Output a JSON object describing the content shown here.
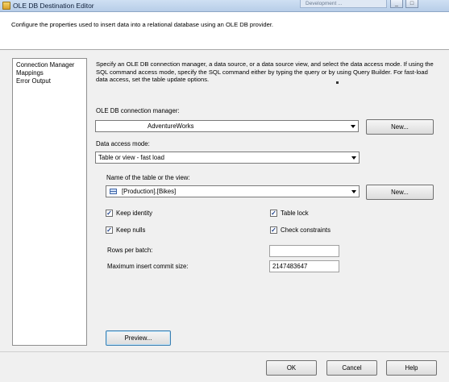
{
  "window": {
    "title": "OLE DB Destination Editor",
    "background_tab": "Development ...",
    "controls": [
      "_",
      "□"
    ]
  },
  "header": {
    "text": "Configure the properties used to insert data into a relational database using an OLE DB provider."
  },
  "nav": {
    "items": [
      "Connection Manager",
      "Mappings",
      "Error Output"
    ]
  },
  "main": {
    "description": "Specify an OLE DB connection manager, a data source, or a data source view, and select the data access mode. If using the SQL command access mode, specify the SQL command either by typing the query or by using Query Builder. For fast-load data access, set the table update options.",
    "connection_manager_label": "OLE DB connection manager:",
    "connection_manager_value": "AdventureWorks",
    "connection_new_button": "New...",
    "access_mode_label": "Data access mode:",
    "access_mode_value": "Table or view - fast load",
    "table_label": "Name of the table or the view:",
    "table_value": "[Production].[Bikes]",
    "table_new_button": "New...",
    "options": {
      "keep_identity": {
        "label": "Keep identity",
        "checked": true
      },
      "table_lock": {
        "label": "Table lock",
        "checked": true
      },
      "keep_nulls": {
        "label": "Keep nulls",
        "checked": true
      },
      "check_constraints": {
        "label": "Check constraints",
        "checked": true
      }
    },
    "rows_per_batch_label": "Rows per batch:",
    "rows_per_batch_value": "",
    "max_commit_label": "Maximum insert commit size:",
    "max_commit_value": "2147483647",
    "preview_button": "Preview..."
  },
  "footer": {
    "ok": "OK",
    "cancel": "Cancel",
    "help": "Help"
  },
  "colors": {
    "titlebar": "#b7cde8",
    "panel": "#f0f0f0",
    "check_mark": "#1c3f8a"
  }
}
